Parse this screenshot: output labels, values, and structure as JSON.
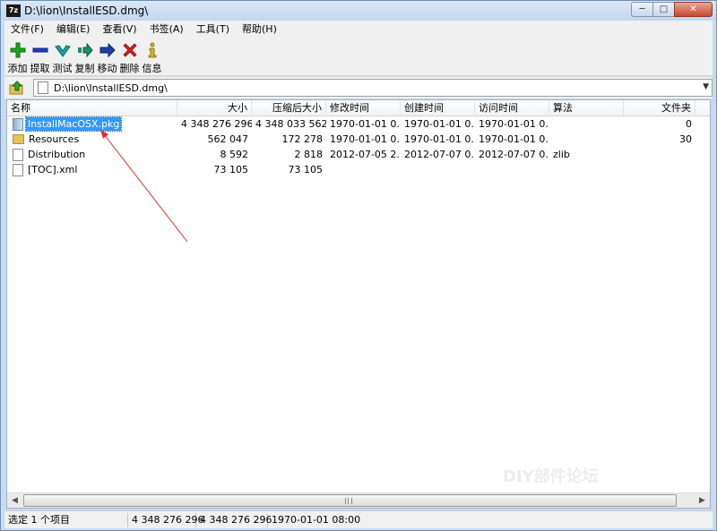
{
  "window": {
    "app_icon": "7z",
    "title": "D:\\lion\\InstallESD.dmg\\",
    "controls": [
      "minimize-icon",
      "maximize-icon",
      "close-icon"
    ]
  },
  "menu": [
    "文件(F)",
    "编辑(E)",
    "查看(V)",
    "书签(A)",
    "工具(T)",
    "帮助(H)"
  ],
  "toolbar": [
    {
      "label": "添加",
      "icon": "add-icon",
      "color": "#1fa31f"
    },
    {
      "label": "提取",
      "icon": "extract-icon",
      "color": "#1f3fbf"
    },
    {
      "label": "测试",
      "icon": "test-icon",
      "color": "#19a3a3"
    },
    {
      "label": "复制",
      "icon": "copy-icon",
      "color": "#1e8c6a"
    },
    {
      "label": "移动",
      "icon": "move-icon",
      "color": "#1f3f9f"
    },
    {
      "label": "删除",
      "icon": "delete-icon",
      "color": "#d81e1e"
    },
    {
      "label": "信息",
      "icon": "info-icon",
      "color": "#d8b21e"
    }
  ],
  "address": {
    "path": "D:\\lion\\InstallESD.dmg\\"
  },
  "columns": [
    "名称",
    "大小",
    "压缩后大小",
    "修改时间",
    "创建时间",
    "访问时间",
    "算法",
    "文件夹"
  ],
  "files": [
    {
      "name": "InstallMacOSX.pkg",
      "icon": "package-icon",
      "selected": true,
      "size": "4 348 276 296",
      "packed": "4 348 033 562",
      "modified": "1970-01-01 0...",
      "created": "1970-01-01 0...",
      "accessed": "1970-01-01 0...",
      "method": "",
      "folders": "0"
    },
    {
      "name": "Resources",
      "icon": "folder-icon",
      "selected": false,
      "size": "562 047",
      "packed": "172 278",
      "modified": "1970-01-01 0...",
      "created": "1970-01-01 0...",
      "accessed": "1970-01-01 0...",
      "method": "",
      "folders": "30"
    },
    {
      "name": "Distribution",
      "icon": "document-icon",
      "selected": false,
      "size": "8 592",
      "packed": "2 818",
      "modified": "2012-07-05 2...",
      "created": "2012-07-07 0...",
      "accessed": "2012-07-07 0...",
      "method": "zlib",
      "folders": ""
    },
    {
      "name": "[TOC].xml",
      "icon": "document-icon",
      "selected": false,
      "size": "73 105",
      "packed": "73 105",
      "modified": "",
      "created": "",
      "accessed": "",
      "method": "",
      "folders": ""
    }
  ],
  "status": {
    "selection": "选定 1 个项目",
    "size": "4 348 276 296",
    "total": "4 348 276 296",
    "date": "1970-01-01 08:00"
  },
  "watermark": "DIY部件论坛",
  "colors": {
    "selection": "#3399ff",
    "annotation_arrow": "#e03030"
  }
}
